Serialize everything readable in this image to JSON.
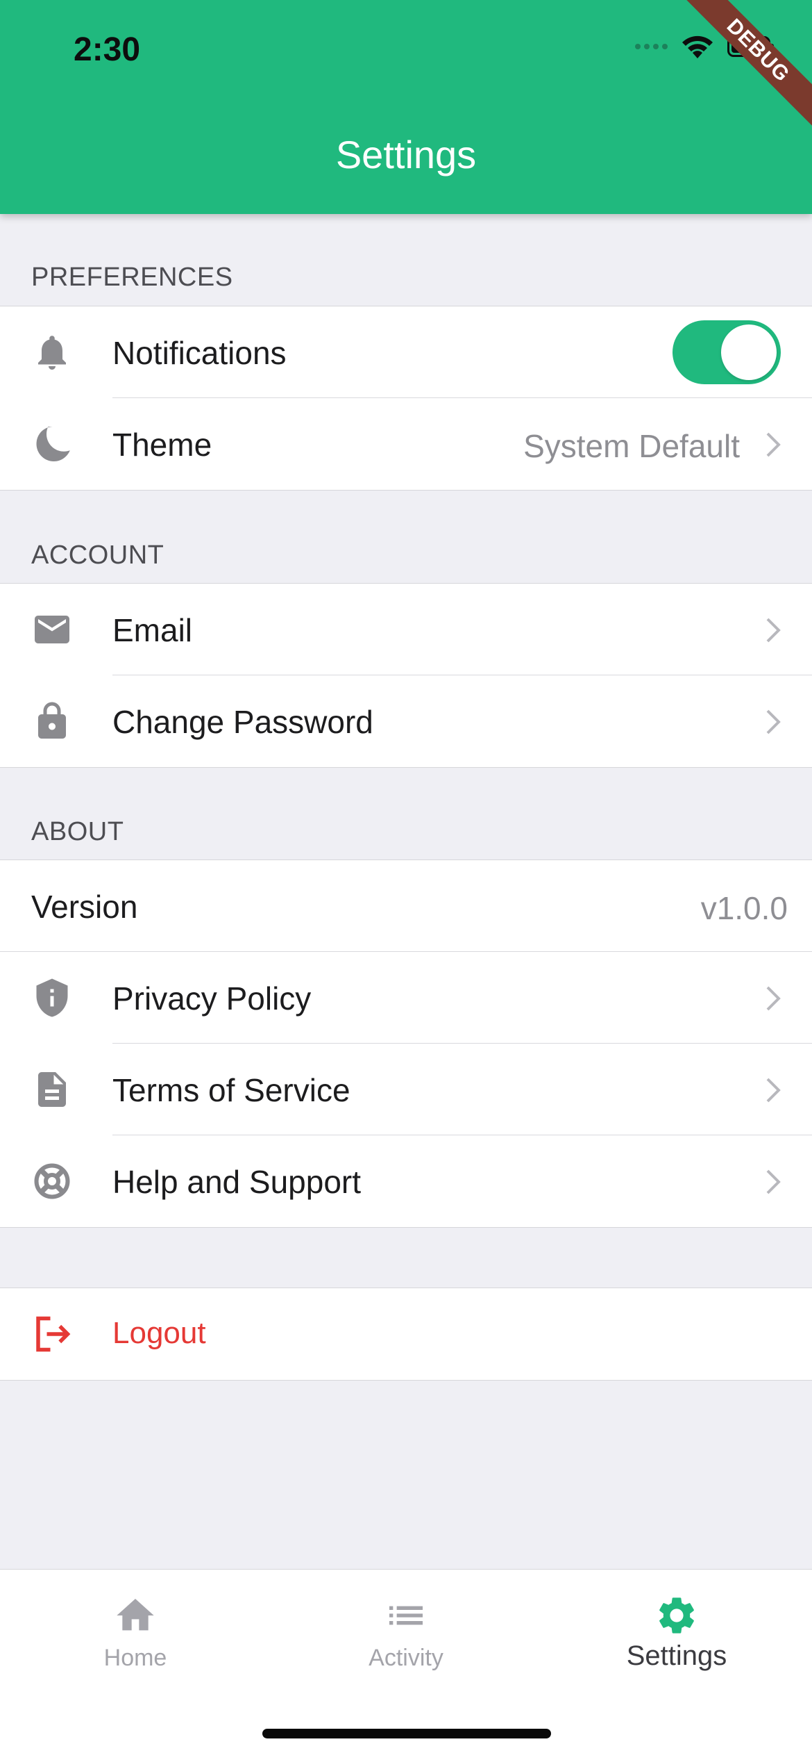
{
  "status_bar": {
    "time": "2:30"
  },
  "debug_banner": "DEBUG",
  "header": {
    "title": "Settings"
  },
  "sections": {
    "preferences": {
      "title": "PREFERENCES",
      "notifications": {
        "label": "Notifications",
        "icon": "bell-icon",
        "enabled": true
      },
      "theme": {
        "label": "Theme",
        "value": "System Default",
        "icon": "moon-icon"
      }
    },
    "account": {
      "title": "ACCOUNT",
      "email": {
        "label": "Email",
        "icon": "mail-icon"
      },
      "change_password": {
        "label": "Change Password",
        "icon": "lock-icon"
      }
    },
    "about": {
      "title": "ABOUT",
      "version": {
        "label": "Version",
        "value": "v1.0.0"
      },
      "privacy_policy": {
        "label": "Privacy Policy",
        "icon": "shield-info-icon"
      },
      "terms_of_service": {
        "label": "Terms of Service",
        "icon": "document-icon"
      },
      "help_support": {
        "label": "Help and Support",
        "icon": "lifebuoy-icon"
      }
    }
  },
  "logout": {
    "label": "Logout",
    "icon": "logout-icon"
  },
  "tabbar": {
    "home": {
      "label": "Home",
      "icon": "home-icon"
    },
    "activity": {
      "label": "Activity",
      "icon": "list-icon"
    },
    "settings": {
      "label": "Settings",
      "icon": "gear-icon",
      "active": true
    }
  },
  "colors": {
    "accent": "#20b97e",
    "danger": "#e53935",
    "background": "#efeff4",
    "icon_gray": "#8a8a8e",
    "debug_ribbon": "#7b3a2d"
  }
}
